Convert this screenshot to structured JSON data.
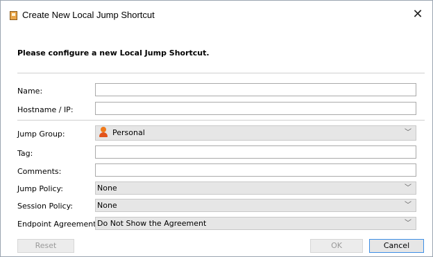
{
  "window": {
    "title": "Create New Local Jump Shortcut",
    "close_glyph": "✕"
  },
  "heading": "Please configure a new Local Jump Shortcut.",
  "fields": {
    "name": {
      "label": "Name:",
      "value": ""
    },
    "hostname": {
      "label": "Hostname / IP:",
      "value": ""
    },
    "jump_group": {
      "label": "Jump Group:",
      "value": "Personal",
      "icon": "person-icon"
    },
    "tag": {
      "label": "Tag:",
      "value": ""
    },
    "comments": {
      "label": "Comments:",
      "value": ""
    },
    "jump_policy": {
      "label": "Jump Policy:",
      "value": "None"
    },
    "session_policy": {
      "label": "Session Policy:",
      "value": "None"
    },
    "endpoint_agreement": {
      "label": "Endpoint Agreement:",
      "value": "Do Not Show the Agreement"
    }
  },
  "buttons": {
    "reset": "Reset",
    "ok": "OK",
    "cancel": "Cancel"
  },
  "icons": {
    "dropdown": "chevron-down-icon"
  },
  "colors": {
    "accent": "#3c8ee6",
    "person_icon": "#f07a1a"
  }
}
